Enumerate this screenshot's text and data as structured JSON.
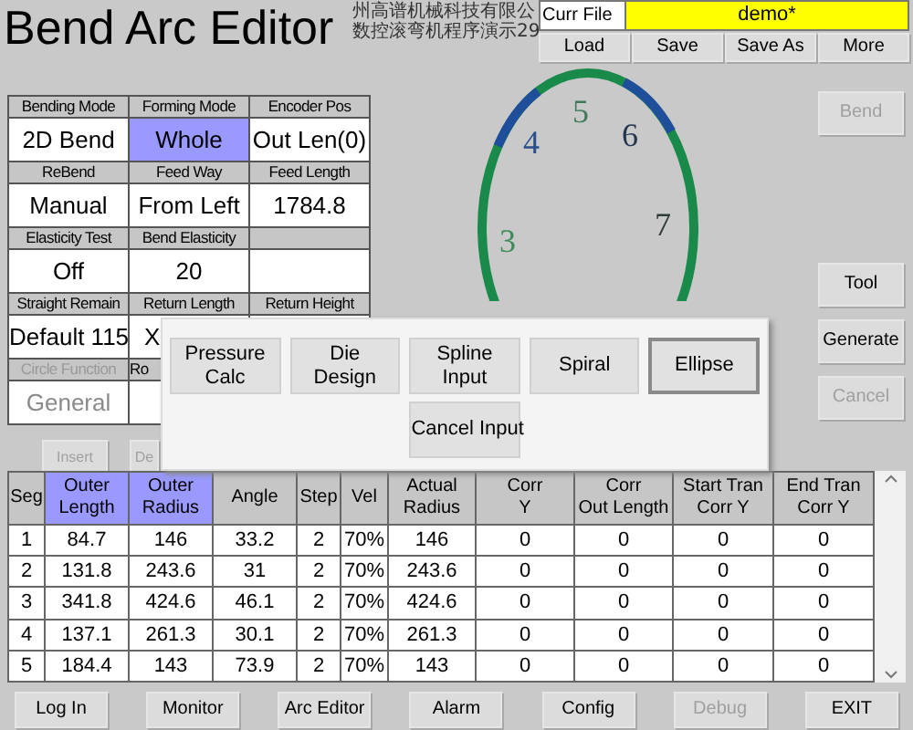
{
  "title": "Bend Arc Editor",
  "company_lines": [
    "州高谱机械科技有限公",
    "数控滚弯机程序演示29"
  ],
  "file": {
    "label": "Curr File",
    "value": "demo*",
    "buttons": [
      "Load",
      "Save",
      "Save As",
      "More"
    ]
  },
  "param_rows": [
    {
      "headers": [
        {
          "text": "Bending Mode",
          "disabled": false
        },
        {
          "text": "Forming Mode",
          "disabled": false
        },
        {
          "text": "Encoder Pos",
          "disabled": false
        }
      ],
      "values": [
        {
          "text": "2D Bend",
          "selected": false,
          "disabled": false
        },
        {
          "text": "Whole",
          "selected": true,
          "disabled": false
        },
        {
          "text": "Out Len(0)",
          "selected": false,
          "disabled": false
        }
      ]
    },
    {
      "headers": [
        {
          "text": "ReBend",
          "disabled": false
        },
        {
          "text": "Feed Way",
          "disabled": false
        },
        {
          "text": "Feed Length",
          "disabled": false
        }
      ],
      "values": [
        {
          "text": "Manual",
          "selected": false,
          "disabled": false
        },
        {
          "text": "From Left",
          "selected": false,
          "disabled": false
        },
        {
          "text": "1784.8",
          "selected": false,
          "disabled": false
        }
      ]
    },
    {
      "headers": [
        {
          "text": "Elasticity Test",
          "disabled": false
        },
        {
          "text": "Bend Elasticity",
          "disabled": false
        }
      ],
      "values": [
        {
          "text": "Off",
          "selected": false,
          "disabled": false
        },
        {
          "text": "20",
          "selected": false,
          "disabled": false
        }
      ]
    },
    {
      "headers": [
        {
          "text": "Straight Remain",
          "disabled": false
        },
        {
          "text": "Return Length",
          "disabled": false
        },
        {
          "text": "Return Height",
          "disabled": false
        }
      ],
      "values": [
        {
          "text": "Default 115",
          "selected": false,
          "disabled": false
        },
        {
          "text": "X",
          "selected": false,
          "disabled": false
        }
      ]
    },
    {
      "headers": [
        {
          "text": "Circle Function",
          "disabled": true
        },
        {
          "text": "Ro",
          "disabled": false
        }
      ],
      "values": [
        {
          "text": "General",
          "selected": false,
          "disabled": true
        }
      ]
    }
  ],
  "edit_buttons": [
    {
      "label": "Insert",
      "disabled": true
    },
    {
      "label": "De",
      "disabled": true
    }
  ],
  "arc_labels": [
    {
      "text": "5",
      "color": "#3f7a5a"
    },
    {
      "text": "4",
      "color": "#2a4f8a"
    },
    {
      "text": "6",
      "color": "#23364f"
    },
    {
      "text": "7",
      "color": "#2f3b35"
    },
    {
      "text": "3",
      "color": "#3f8a5a"
    }
  ],
  "side_buttons": [
    {
      "label": "Bend",
      "disabled": true
    },
    {
      "label": "Tool",
      "disabled": false
    },
    {
      "label": "Generate",
      "disabled": false
    },
    {
      "label": "Cancel",
      "disabled": true
    }
  ],
  "dialog": {
    "buttons": [
      {
        "label": "Pressure Calc",
        "selected": false
      },
      {
        "label": "Die Design",
        "selected": false
      },
      {
        "label": "Spline Input",
        "selected": false
      },
      {
        "label": "Spiral",
        "selected": false
      },
      {
        "label": "Ellipse",
        "selected": true
      }
    ],
    "cancel": "Cancel Input"
  },
  "table": {
    "columns": [
      {
        "label": "Seg",
        "selected": false
      },
      {
        "label": "Outer\nLength",
        "selected": true
      },
      {
        "label": "Outer\nRadius",
        "selected": true
      },
      {
        "label": "Angle",
        "selected": false
      },
      {
        "label": "Step",
        "selected": false
      },
      {
        "label": "Vel",
        "selected": false
      },
      {
        "label": "Actual\nRadius",
        "selected": false
      },
      {
        "label": "Corr\nY",
        "selected": false
      },
      {
        "label": "Corr\nOut Length",
        "selected": false
      },
      {
        "label": "Start Tran\nCorr Y",
        "selected": false
      },
      {
        "label": "End Tran\nCorr Y",
        "selected": false
      }
    ],
    "rows": [
      [
        "1",
        "84.7",
        "146",
        "33.2",
        "2",
        "70%",
        "146",
        "0",
        "0",
        "0",
        "0"
      ],
      [
        "2",
        "131.8",
        "243.6",
        "31",
        "2",
        "70%",
        "243.6",
        "0",
        "0",
        "0",
        "0"
      ],
      [
        "3",
        "341.8",
        "424.6",
        "46.1",
        "2",
        "70%",
        "424.6",
        "0",
        "0",
        "0",
        "0"
      ],
      [
        "4",
        "137.1",
        "261.3",
        "30.1",
        "2",
        "70%",
        "261.3",
        "0",
        "0",
        "0",
        "0"
      ],
      [
        "5",
        "184.4",
        "143",
        "73.9",
        "2",
        "70%",
        "143",
        "0",
        "0",
        "0",
        "0"
      ]
    ]
  },
  "nav": [
    {
      "label": "Log In",
      "disabled": false
    },
    {
      "label": "Monitor",
      "disabled": false
    },
    {
      "label": "Arc Editor",
      "disabled": false
    },
    {
      "label": "Alarm",
      "disabled": false
    },
    {
      "label": "Config",
      "disabled": false
    },
    {
      "label": "Debug",
      "disabled": true
    },
    {
      "label": "EXIT",
      "disabled": false
    }
  ]
}
